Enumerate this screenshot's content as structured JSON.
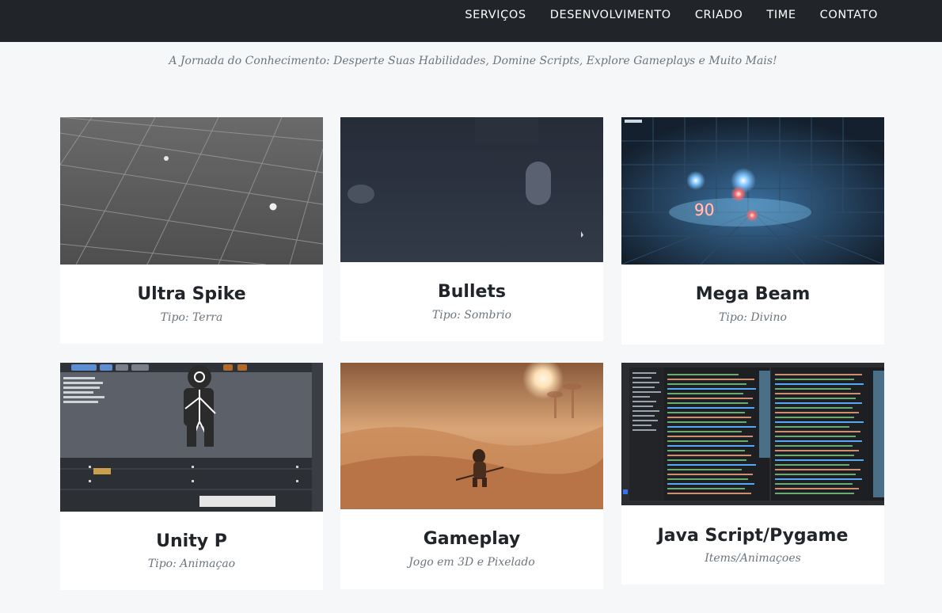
{
  "nav": {
    "items": [
      {
        "label": "SERVIÇOS"
      },
      {
        "label": "DESENVOLVIMENTO"
      },
      {
        "label": "CRIADO"
      },
      {
        "label": "TIME"
      },
      {
        "label": "CONTATO"
      }
    ]
  },
  "subheading": "A Jornada do Conhecimento: Desperte Suas Habilidades, Domine Scripts, Explore Gameplays e Muito Mais!",
  "portfolio": {
    "items": [
      {
        "title": "Ultra Spike",
        "subtitle": "Tipo: Terra"
      },
      {
        "title": "Bullets",
        "subtitle": "Tipo: Sombrio"
      },
      {
        "title": "Mega Beam",
        "subtitle": "Tipo: Divino"
      },
      {
        "title": "Unity P",
        "subtitle": "Tipo: Animaçao"
      },
      {
        "title": "Gameplay",
        "subtitle": "Jogo em 3D e Pixelado"
      },
      {
        "title": "Java Script/Pygame",
        "subtitle": "Items/Animaçoes"
      }
    ]
  },
  "colors": {
    "navbar": "#212529",
    "page_background": "#f5f7f9",
    "card_background": "#ffffff",
    "title_text": "#212529",
    "muted_text": "#6c757d"
  }
}
